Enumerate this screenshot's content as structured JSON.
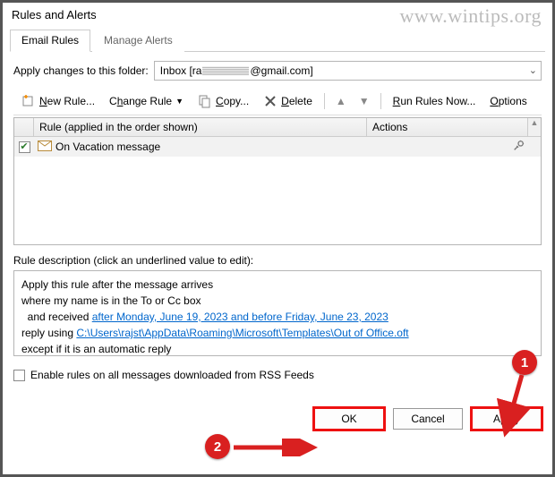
{
  "window": {
    "title": "Rules and Alerts"
  },
  "watermark": "www.wintips.org",
  "tabs": {
    "email_rules": "Email Rules",
    "manage_alerts": "Manage Alerts",
    "active": "email_rules"
  },
  "folder": {
    "label": "Apply changes to this folder:",
    "value_prefix": "Inbox [ra",
    "value_suffix": "@gmail.com]"
  },
  "toolbar": {
    "new_rule": "New Rule...",
    "change_rule": "Change Rule",
    "copy": "Copy...",
    "delete": "Delete",
    "run_now": "Run Rules Now...",
    "options": "Options"
  },
  "rule_table": {
    "header_rule": "Rule (applied in the order shown)",
    "header_actions": "Actions",
    "rows": [
      {
        "checked": true,
        "name": "On Vacation message"
      }
    ]
  },
  "description": {
    "label": "Rule description (click an underlined value to edit):",
    "line1": "Apply this rule after the message arrives",
    "line2": "where my name is in the To or Cc box",
    "line3_prefix": "  and received ",
    "line3_link": "after Monday, June 19, 2023 and before Friday, June 23, 2023",
    "line4_prefix": "reply using ",
    "line4_link": "C:\\Users\\rajst\\AppData\\Roaming\\Microsoft\\Templates\\Out of Office.oft",
    "line5": "except if it is an automatic reply"
  },
  "rss": {
    "label": "Enable rules on all messages downloaded from RSS Feeds"
  },
  "buttons": {
    "ok": "OK",
    "cancel": "Cancel",
    "apply": "Apply"
  },
  "annotations": {
    "badge1": "1",
    "badge2": "2"
  }
}
